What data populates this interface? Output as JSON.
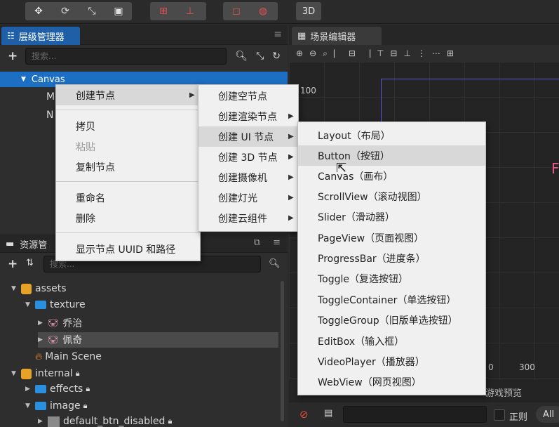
{
  "toolbar": {
    "view3d_label": "3D"
  },
  "hierarchy": {
    "tab_title": "层级管理器",
    "search_placeholder": "搜索...",
    "nodes": [
      {
        "label": "Canvas"
      },
      {
        "label": "M"
      },
      {
        "label": "N"
      }
    ]
  },
  "scene_editor": {
    "tab_title": "场景编辑器",
    "ruler_labels": {
      "left": "100",
      "bottom_mid": "0",
      "bottom_right": "300"
    },
    "partial_text": "F"
  },
  "assets": {
    "tab_title": "资源管",
    "search_placeholder": "搜索...",
    "tree": [
      {
        "label": "assets"
      },
      {
        "label": "texture"
      },
      {
        "label": "乔治"
      },
      {
        "label": "佩奇"
      },
      {
        "label": "Main Scene"
      },
      {
        "label": "internal"
      },
      {
        "label": "effects"
      },
      {
        "label": "image"
      },
      {
        "label": "default_btn_disabled"
      }
    ]
  },
  "console": {
    "tab_preview": "游戏预览",
    "regex_label": "正则",
    "level_label": "All"
  },
  "context_menu": {
    "items": [
      {
        "label": "创建节点",
        "submenu": true
      },
      {
        "label": "拷贝"
      },
      {
        "label": "粘贴",
        "disabled": true
      },
      {
        "label": "复制节点"
      },
      {
        "label": "重命名"
      },
      {
        "label": "删除"
      },
      {
        "label": "显示节点 UUID 和路径"
      }
    ]
  },
  "create_menu": {
    "items": [
      {
        "label": "创建空节点"
      },
      {
        "label": "创建渲染节点",
        "submenu": true
      },
      {
        "label": "创建 UI 节点",
        "submenu": true
      },
      {
        "label": "创建 3D 节点",
        "submenu": true
      },
      {
        "label": "创建摄像机",
        "submenu": true
      },
      {
        "label": "创建灯光",
        "submenu": true
      },
      {
        "label": "创建云组件",
        "submenu": true
      }
    ]
  },
  "ui_menu": {
    "items": [
      {
        "label": "Layout（布局）"
      },
      {
        "label": "Button（按钮）"
      },
      {
        "label": "Canvas（画布）"
      },
      {
        "label": "ScrollView（滚动视图）"
      },
      {
        "label": "Slider（滑动器）"
      },
      {
        "label": "PageView（页面视图）"
      },
      {
        "label": "ProgressBar（进度条）"
      },
      {
        "label": "Toggle（复选按钮）"
      },
      {
        "label": "ToggleContainer（单选按钮）"
      },
      {
        "label": "ToggleGroup（旧版单选按钮）"
      },
      {
        "label": "EditBox（输入框）"
      },
      {
        "label": "VideoPlayer（播放器）"
      },
      {
        "label": "WebView（网页视图）"
      }
    ]
  },
  "colors": {
    "accent": "#1d6fc4",
    "menu_bg": "#f0f0f0",
    "folder": "#2b8fe0",
    "db": "#e8a326"
  }
}
